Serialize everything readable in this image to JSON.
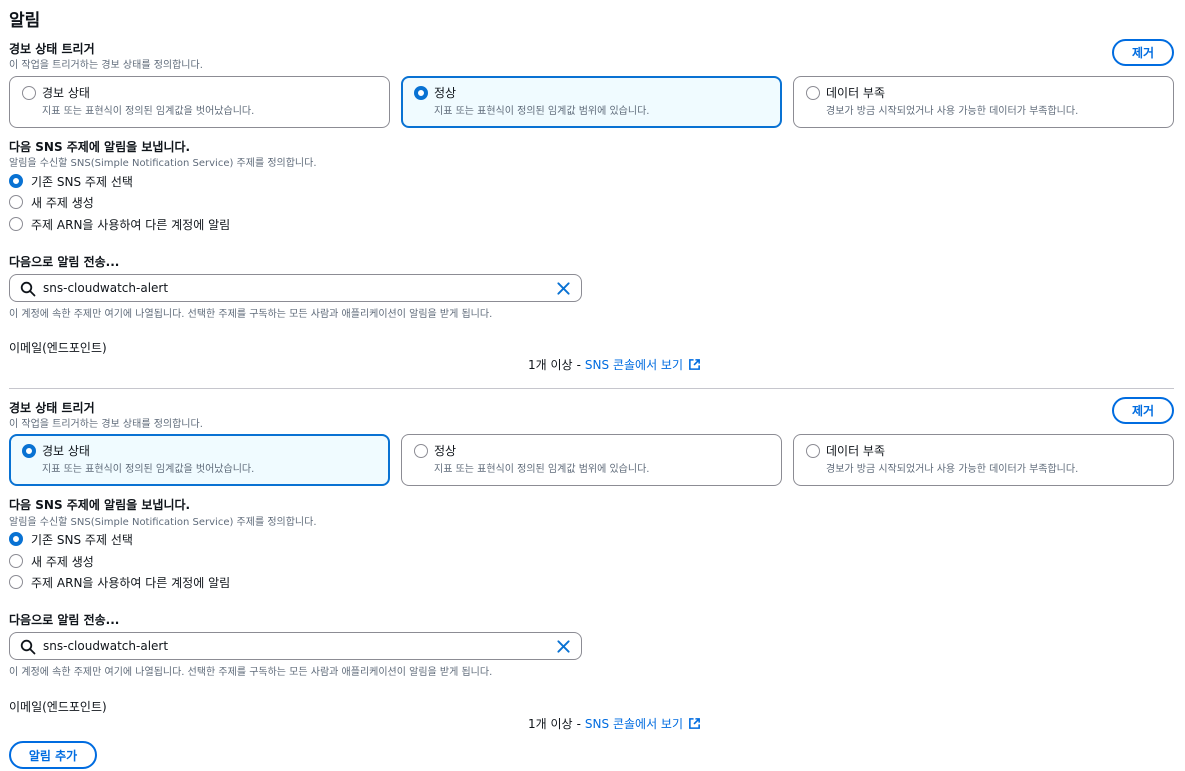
{
  "page": {
    "title": "알림"
  },
  "notifications": [
    {
      "trigger_label": "경보 상태 트리거",
      "trigger_desc": "이 작업을 트리거하는 경보 상태를 정의합니다.",
      "remove_label": "제거",
      "states": [
        {
          "title": "경보 상태",
          "desc": "지표 또는 표현식이 정의된 임계값을 벗어났습니다.",
          "selected": false
        },
        {
          "title": "정상",
          "desc": "지표 또는 표현식이 정의된 임계값 범위에 있습니다.",
          "selected": true
        },
        {
          "title": "데이터 부족",
          "desc": "경보가 방금 시작되었거나 사용 가능한 데이터가 부족합니다.",
          "selected": false
        }
      ],
      "sns_label": "다음 SNS 주제에 알림을 보냅니다.",
      "sns_desc": "알림을 수신할 SNS(Simple Notification Service) 주제를 정의합니다.",
      "sns_options": [
        {
          "label": "기존 SNS 주제 선택",
          "checked": true
        },
        {
          "label": "새 주제 생성",
          "checked": false
        },
        {
          "label": "주제 ARN을 사용하여 다른 계정에 알림",
          "checked": false
        }
      ],
      "send_label": "다음으로 알림 전송...",
      "topic_value": "sns-cloudwatch-alert",
      "constraint": "이 계정에 속한 주제만 여기에 나열됩니다. 선택한 주제를 구독하는 모든 사람과 애플리케이션이 알림을 받게 됩니다.",
      "endpoint_label": "이메일(엔드포인트)",
      "endpoint_count": "1개 이상",
      "endpoint_sep": "-",
      "endpoint_link": "SNS 콘솔에서 보기"
    },
    {
      "trigger_label": "경보 상태 트리거",
      "trigger_desc": "이 작업을 트리거하는 경보 상태를 정의합니다.",
      "remove_label": "제거",
      "states": [
        {
          "title": "경보 상태",
          "desc": "지표 또는 표현식이 정의된 임계값을 벗어났습니다.",
          "selected": true
        },
        {
          "title": "정상",
          "desc": "지표 또는 표현식이 정의된 임계값 범위에 있습니다.",
          "selected": false
        },
        {
          "title": "데이터 부족",
          "desc": "경보가 방금 시작되었거나 사용 가능한 데이터가 부족합니다.",
          "selected": false
        }
      ],
      "sns_label": "다음 SNS 주제에 알림을 보냅니다.",
      "sns_desc": "알림을 수신할 SNS(Simple Notification Service) 주제를 정의합니다.",
      "sns_options": [
        {
          "label": "기존 SNS 주제 선택",
          "checked": true
        },
        {
          "label": "새 주제 생성",
          "checked": false
        },
        {
          "label": "주제 ARN을 사용하여 다른 계정에 알림",
          "checked": false
        }
      ],
      "send_label": "다음으로 알림 전송...",
      "topic_value": "sns-cloudwatch-alert",
      "constraint": "이 계정에 속한 주제만 여기에 나열됩니다. 선택한 주제를 구독하는 모든 사람과 애플리케이션이 알림을 받게 됩니다.",
      "endpoint_label": "이메일(엔드포인트)",
      "endpoint_count": "1개 이상",
      "endpoint_sep": "-",
      "endpoint_link": "SNS 콘솔에서 보기"
    }
  ],
  "add_button": {
    "label": "알림 추가"
  },
  "colors": {
    "accent": "#0972d3",
    "link": "#006ce0",
    "text": "#0f141a",
    "muted": "#5f6b7a",
    "border": "#8c8c94"
  },
  "icons": {
    "search": "search-icon",
    "clear": "close-icon",
    "external": "external-link-icon"
  }
}
